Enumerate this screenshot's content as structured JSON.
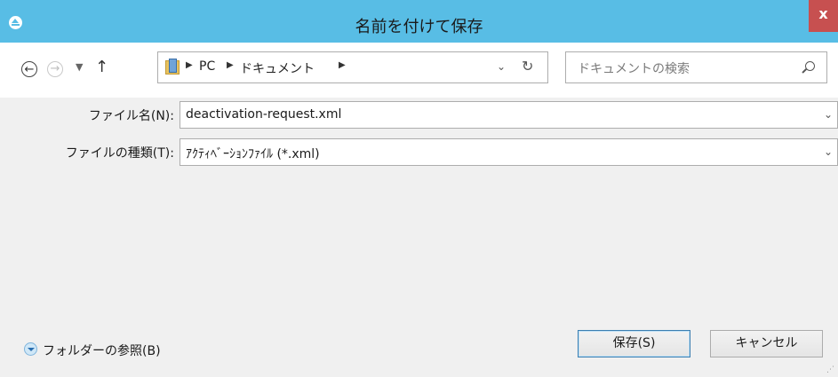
{
  "window": {
    "title": "名前を付けて保存",
    "close_label": "x"
  },
  "navigation": {
    "breadcrumbs": [
      "PC",
      "ドキュメント"
    ],
    "search_placeholder": "ドキュメントの検索"
  },
  "form": {
    "filename_label": "ファイル名(N):",
    "filename_value": "deactivation-request.xml",
    "filetype_label": "ファイルの種類(T):",
    "filetype_value": "ｱｸﾃｨﾍﾞｰｼｮﾝﾌｧｲﾙ (*.xml)"
  },
  "footer": {
    "browse_folders_label": "フォルダーの参照(B)",
    "save_label": "保存(S)",
    "cancel_label": "キャンセル"
  },
  "colors": {
    "titlebar": "#58bde5",
    "close_button": "#c75050",
    "body_background": "#f0f0f0"
  },
  "icons": [
    "app-icon",
    "close-icon",
    "back-arrow-icon",
    "forward-arrow-icon",
    "recent-locations-icon",
    "up-arrow-icon",
    "folder-icon",
    "chevron-right-icon",
    "chevron-down-icon",
    "refresh-icon",
    "search-icon",
    "expand-circle-icon"
  ]
}
